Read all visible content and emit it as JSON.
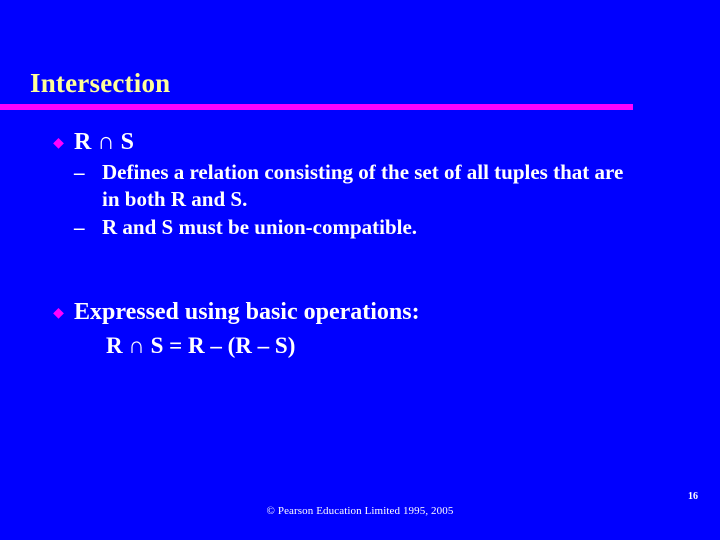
{
  "slide": {
    "title": "Intersection",
    "accent_rule_color": "#ff00ff",
    "background_color": "#0000ff",
    "title_color": "#ffff99",
    "body_color": "#ffffff",
    "bullet_glyph": "♦",
    "dash_glyph": "–",
    "bullets": [
      {
        "text": "R ∩ S",
        "sub": [
          "Defines a relation consisting of the set of all tuples that are in both R and S.",
          "R and S must be union-compatible."
        ]
      },
      {
        "text": "Expressed using basic operations:",
        "formula": "R ∩ S = R – (R – S)"
      }
    ],
    "footer": {
      "copyright": "© Pearson Education Limited 1995, 2005",
      "slide_number": "16"
    }
  }
}
